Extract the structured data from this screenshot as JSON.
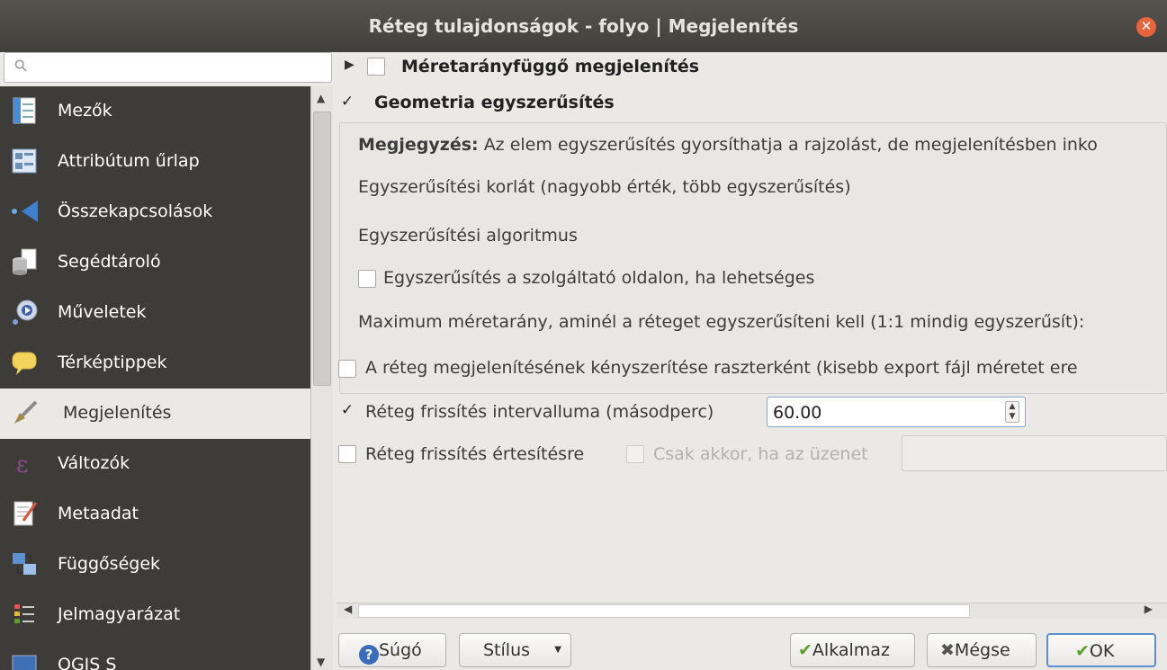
{
  "window": {
    "title": "Réteg tulajdonságok - folyo | Megjelenítés",
    "close_glyph": "✕"
  },
  "search": {
    "icon": "search-icon",
    "placeholder": ""
  },
  "sidebar": {
    "items": [
      {
        "label": "Mezők",
        "icon": "fields-icon"
      },
      {
        "label": "Attribútum űrlap",
        "icon": "form-icon"
      },
      {
        "label": "Összekapcsolások",
        "icon": "joins-icon"
      },
      {
        "label": "Segédtároló",
        "icon": "auxiliary-storage-icon"
      },
      {
        "label": "Műveletek",
        "icon": "actions-icon"
      },
      {
        "label": "Térképtippek",
        "icon": "map-tips-icon"
      },
      {
        "label": "Megjelenítés",
        "icon": "rendering-brush-icon",
        "active": true
      },
      {
        "label": "Változók",
        "icon": "variables-icon"
      },
      {
        "label": "Metaadat",
        "icon": "metadata-icon"
      },
      {
        "label": "Függőségek",
        "icon": "dependencies-icon"
      },
      {
        "label": "Jelmagyarázat",
        "icon": "legend-icon"
      },
      {
        "label": "QGIS S",
        "icon": "server-icon"
      }
    ]
  },
  "main": {
    "scale_dependent": {
      "label": "Méretarányfüggő megjelenítés",
      "checked": false,
      "expanded": false
    },
    "simplify": {
      "label": "Geometria egyszerűsítés",
      "checked": true,
      "note_bold": "Megjegyzés:",
      "note_text": "Az elem egyszerűsítés gyorsíthatja a rajzolást, de megjelenítésben inko",
      "threshold_label": "Egyszerűsítési korlát (nagyobb érték, több egyszerűsítés)",
      "algorithm_label": "Egyszerűsítési algoritmus",
      "provider_label": "Egyszerűsítés a szolgáltató oldalon, ha lehetséges",
      "provider_checked": false,
      "max_scale_label": "Maximum méretarány, aminél a réteget egyszerűsíteni kell (1:1 mindig egyszerűsít):"
    },
    "force_raster": {
      "label": "A réteg megjelenítésének kényszerítése raszterként (kisebb export fájl méretet ere",
      "checked": false
    },
    "refresh_interval": {
      "label": "Réteg frissítés intervalluma (másodperc)",
      "checked": true,
      "value": "60.00"
    },
    "refresh_notification": {
      "label": "Réteg frissítés értesítésre",
      "checked": false
    },
    "only_if_message": {
      "label": "Csak akkor, ha az üzenet",
      "checked": false,
      "enabled": false
    }
  },
  "buttons": {
    "help": "Súgó",
    "style": "Stílus",
    "apply": "Alkalmaz",
    "cancel": "Mégse",
    "ok": "OK"
  },
  "colors": {
    "titlebar": "#45443f",
    "sidebar_bg": "#3d3c38",
    "close": "#e9643c",
    "accent_green": "#5aa02c"
  }
}
